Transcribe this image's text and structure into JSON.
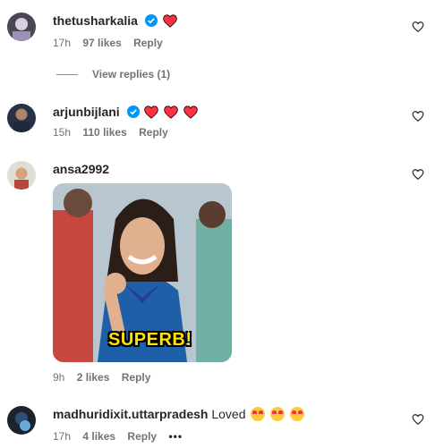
{
  "comments": [
    {
      "username": "thetusharkalia",
      "time": "17h",
      "likes": "97 likes",
      "reply": "Reply"
    },
    {
      "username": "arjunbijlani",
      "time": "15h",
      "likes": "110 likes",
      "reply": "Reply"
    },
    {
      "username": "ansa2992",
      "time": "9h",
      "likes": "2 likes",
      "reply": "Reply",
      "gif_caption": "SUPERB!"
    },
    {
      "username": "madhuridixit.uttarpradesh",
      "text": "Loved",
      "time": "17h",
      "likes": "4 likes",
      "reply": "Reply",
      "more": "•••"
    }
  ],
  "view_replies": "View replies (1)",
  "colors": {
    "heart": "#ff3040",
    "verified": "#0095f6",
    "muted": "#737373"
  }
}
